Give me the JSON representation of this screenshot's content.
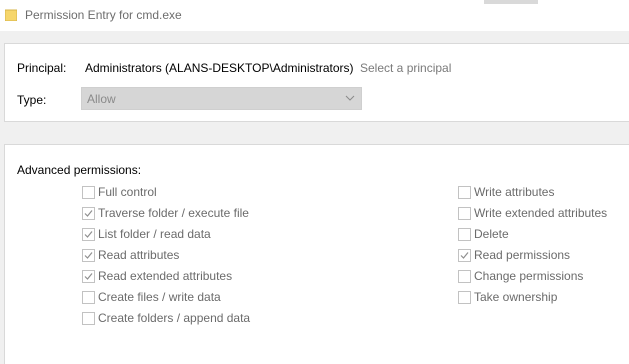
{
  "window": {
    "title": "Permission Entry for cmd.exe"
  },
  "principal": {
    "label": "Principal:",
    "value": "Administrators (ALANS-DESKTOP\\Administrators)",
    "select_link": "Select a principal"
  },
  "type": {
    "label": "Type:",
    "selected": "Allow"
  },
  "advanced": {
    "heading": "Advanced permissions:",
    "left": [
      {
        "label": "Full control",
        "checked": false
      },
      {
        "label": "Traverse folder / execute file",
        "checked": true
      },
      {
        "label": "List folder / read data",
        "checked": true
      },
      {
        "label": "Read attributes",
        "checked": true
      },
      {
        "label": "Read extended attributes",
        "checked": true
      },
      {
        "label": "Create files / write data",
        "checked": false
      },
      {
        "label": "Create folders / append data",
        "checked": false
      }
    ],
    "right": [
      {
        "label": "Write attributes",
        "checked": false
      },
      {
        "label": "Write extended attributes",
        "checked": false
      },
      {
        "label": "Delete",
        "checked": false
      },
      {
        "label": "Read permissions",
        "checked": true
      },
      {
        "label": "Change permissions",
        "checked": false
      },
      {
        "label": "Take ownership",
        "checked": false
      }
    ]
  },
  "colors": {
    "folder_icon": "#f6d66b",
    "disabled_text": "#6b6b6b",
    "link": "#7a7a7a"
  }
}
